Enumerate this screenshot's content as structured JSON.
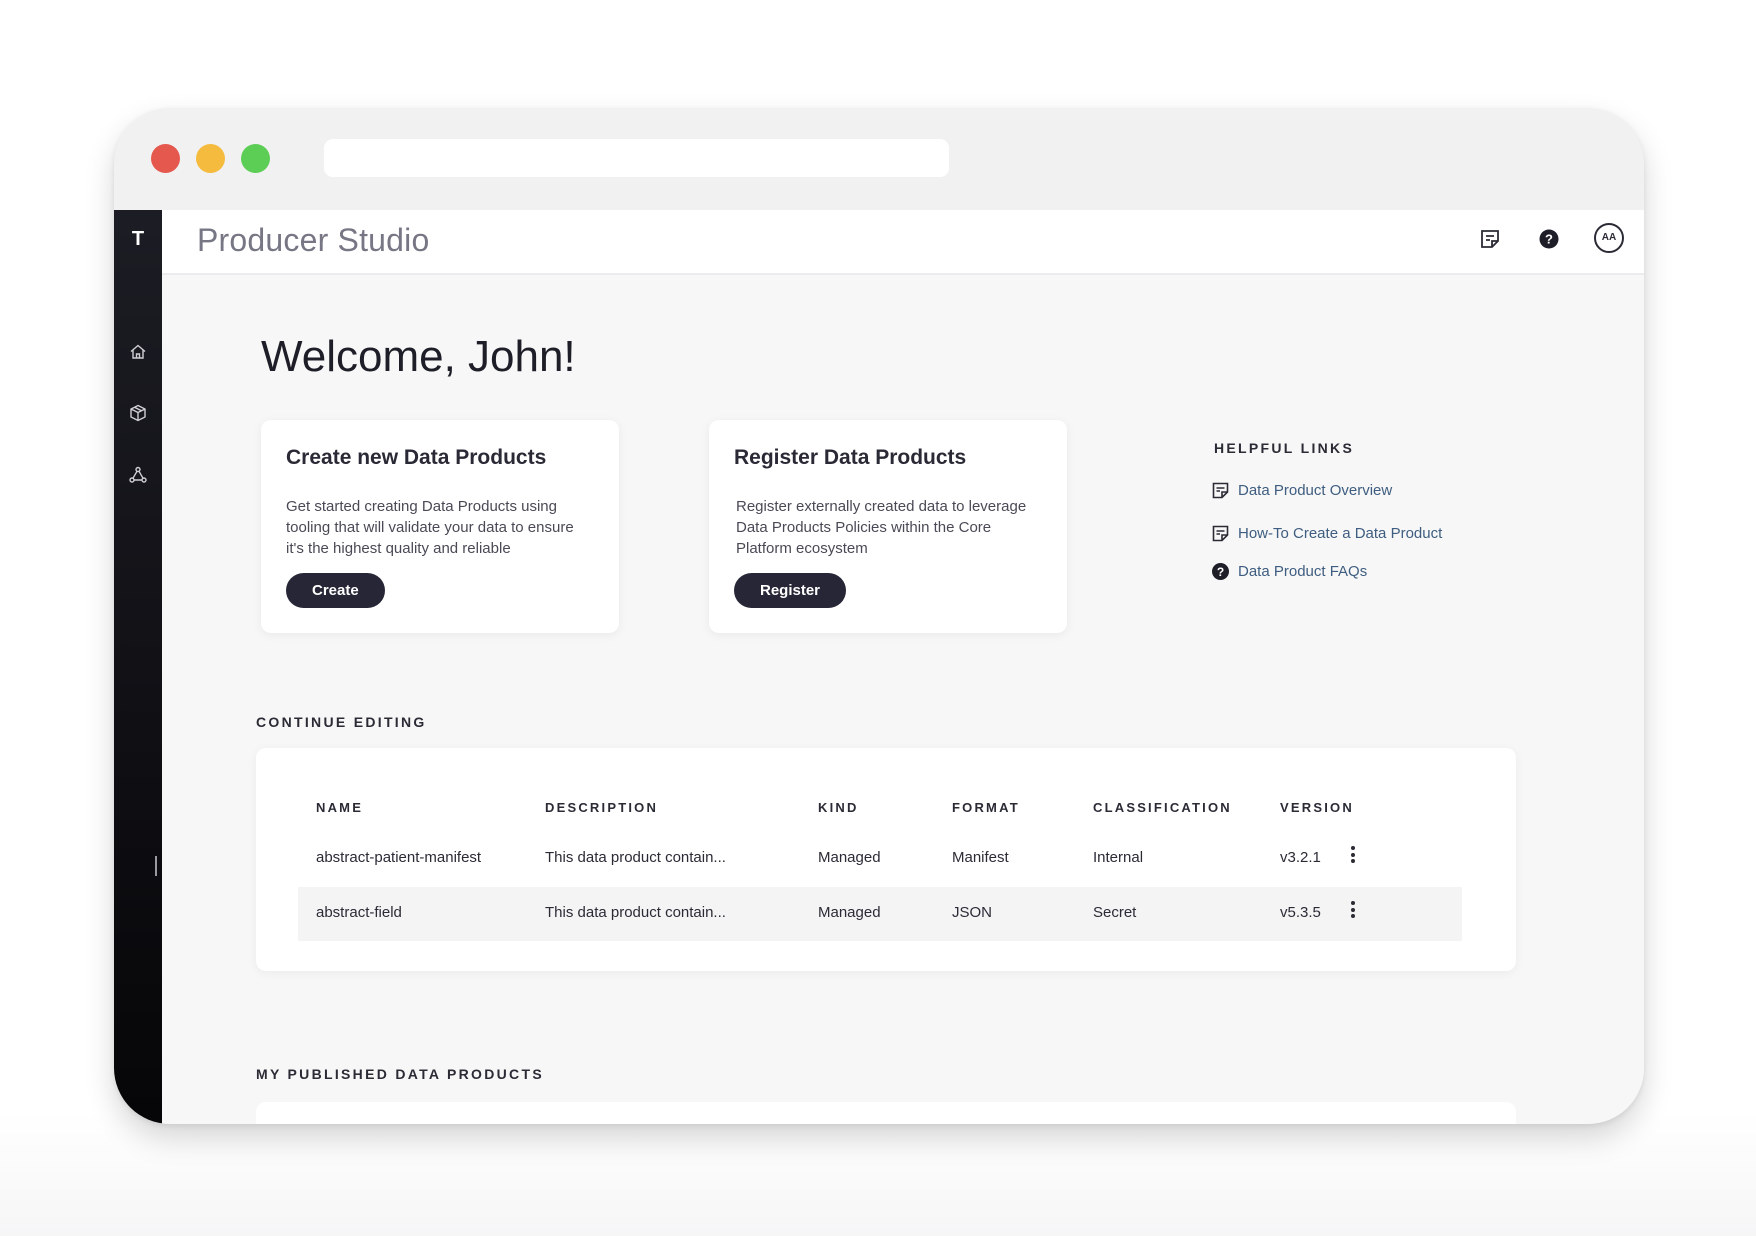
{
  "app": {
    "title": "Producer Studio",
    "logo": "T",
    "avatar_initials": "AA"
  },
  "rail": {
    "items": [
      "home-icon",
      "cube-icon",
      "network-icon"
    ]
  },
  "topbar": {
    "icons": [
      "notes-icon",
      "help-icon",
      "avatar-icon"
    ]
  },
  "welcome": "Welcome, John!",
  "cards": [
    {
      "title": "Create new Data Products",
      "body": "Get started creating Data Products using tooling that will validate your data to ensure it's the highest quality and reliable",
      "button": "Create"
    },
    {
      "title": "Register Data Products",
      "body": "Register externally created data to leverage Data Products Policies within the Core Platform ecosystem",
      "button": "Register"
    }
  ],
  "helpful": {
    "title": "HELPFUL LINKS",
    "links": [
      {
        "label": "Data Product Overview",
        "icon": "doc-icon"
      },
      {
        "label": "How-To Create a Data Product",
        "icon": "doc-icon"
      },
      {
        "label": "Data Product FAQs",
        "icon": "help-icon"
      }
    ]
  },
  "continue_editing": {
    "title": "CONTINUE EDITING",
    "columns": [
      "NAME",
      "DESCRIPTION",
      "KIND",
      "FORMAT",
      "CLASSIFICATION",
      "VERSION"
    ],
    "rows": [
      [
        "abstract-patient-manifest",
        "This data product contain...",
        "Managed",
        "Manifest",
        "Internal",
        "v3.2.1"
      ],
      [
        "abstract-field",
        "This data product contain...",
        "Managed",
        "JSON",
        "Secret",
        "v5.3.5"
      ]
    ]
  },
  "published": {
    "title": "MY PUBLISHED DATA PRODUCTS"
  },
  "colors": {
    "accent": "#262636",
    "link": "#3e5d80",
    "rail": "#111118"
  }
}
